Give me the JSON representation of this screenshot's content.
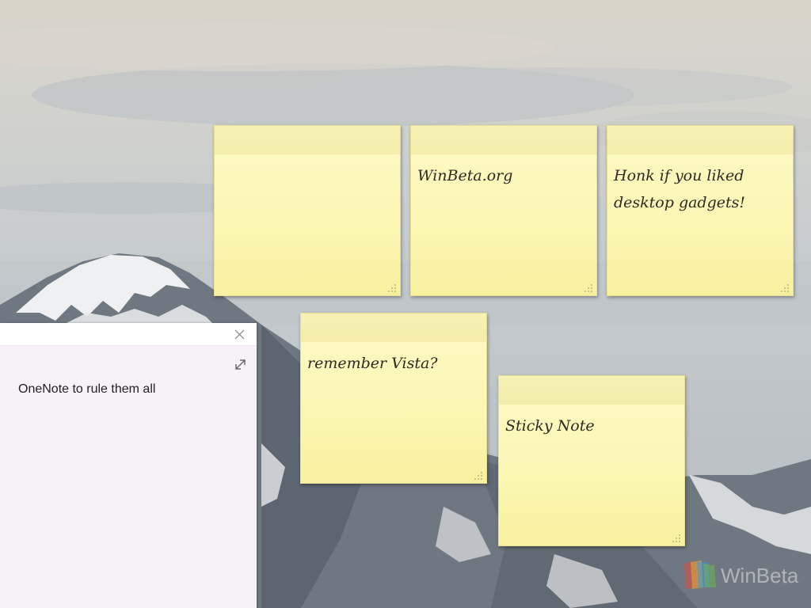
{
  "sticky_notes": [
    {
      "text_lines": []
    },
    {
      "text_lines": [
        "WinBeta.org"
      ]
    },
    {
      "text_lines": [
        "Honk if you liked",
        "desktop gadgets!"
      ]
    },
    {
      "text_lines": [
        "remember Vista?"
      ]
    },
    {
      "text_lines": [
        "Sticky Note"
      ]
    }
  ],
  "onenote_panel": {
    "note_text": "OneNote to rule them all",
    "close_icon": "close-icon",
    "expand_icon": "expand-icon"
  },
  "watermark": {
    "text": "WinBeta"
  },
  "colors": {
    "note_body": "#fbf6b2",
    "note_header": "#f5efae",
    "onenote_panel": "#f6f2f7"
  }
}
